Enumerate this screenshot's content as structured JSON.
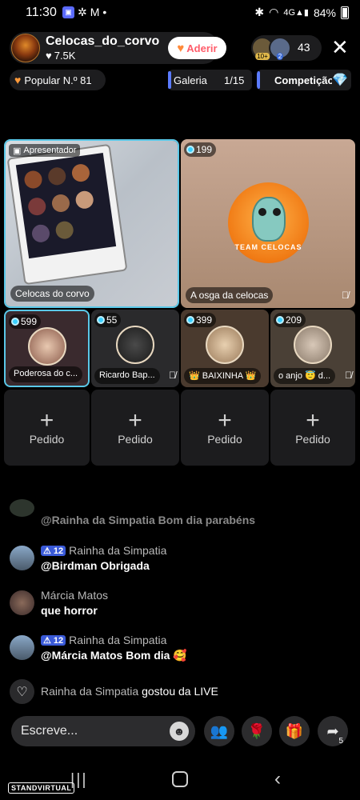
{
  "status_bar": {
    "time": "11:30",
    "icons_left": [
      "app-badge-icon",
      "pinwheel-icon",
      "mail-icon"
    ],
    "battery": "84%"
  },
  "header": {
    "host_name": "Celocas_do_corvo",
    "host_likes": "7.5K",
    "follow_label": "Aderir",
    "viewer_badge_1": "10+",
    "viewer_badge_2": "2",
    "viewer_count": "43"
  },
  "subheader": {
    "popular_label": "Popular N.º 81",
    "gallery_label": "Galeria",
    "gallery_count": "1/15",
    "competition_label": "Competição"
  },
  "tiles": {
    "presenter_tag": "Apresentador",
    "t1_label": "Celocas do corvo",
    "t2_count": "199",
    "t2_label": "A osga da celocas",
    "t2_logo_text": "TEAM CELOCAS",
    "t3_count": "599",
    "t3_label": "Poderosa do c...",
    "t4_count": "55",
    "t4_label": "Ricardo Bap...",
    "t5_count": "399",
    "t5_label": "👑 BAIXINHA 👑",
    "t6_count": "209",
    "t6_label": "o anjo 😇 d..."
  },
  "empty_slots": {
    "label": "Pedido",
    "plus": "+"
  },
  "chat": {
    "m0_text": "@Rainha da Simpatia Bom dia parabéns",
    "m1_level": "12",
    "m1_user": "Rainha da Simpatia",
    "m1_text": "@Birdman Obrigada",
    "m2_user": "Márcia Matos",
    "m2_text": "que horror",
    "m3_level": "12",
    "m3_user": "Rainha da Simpatia",
    "m3_text": "@Márcia Matos Bom dia 🥰",
    "like_user": "Rainha da Simpatia",
    "like_text": "gostou da LIVE"
  },
  "bottom_bar": {
    "input_placeholder": "Escreve...",
    "share_count": "5"
  },
  "watermark": "STANDVIRTUAL",
  "colors": {
    "accent_blue": "#5b7bff",
    "follow_red": "#ff5c6a",
    "active_border": "#5ac8e8"
  }
}
